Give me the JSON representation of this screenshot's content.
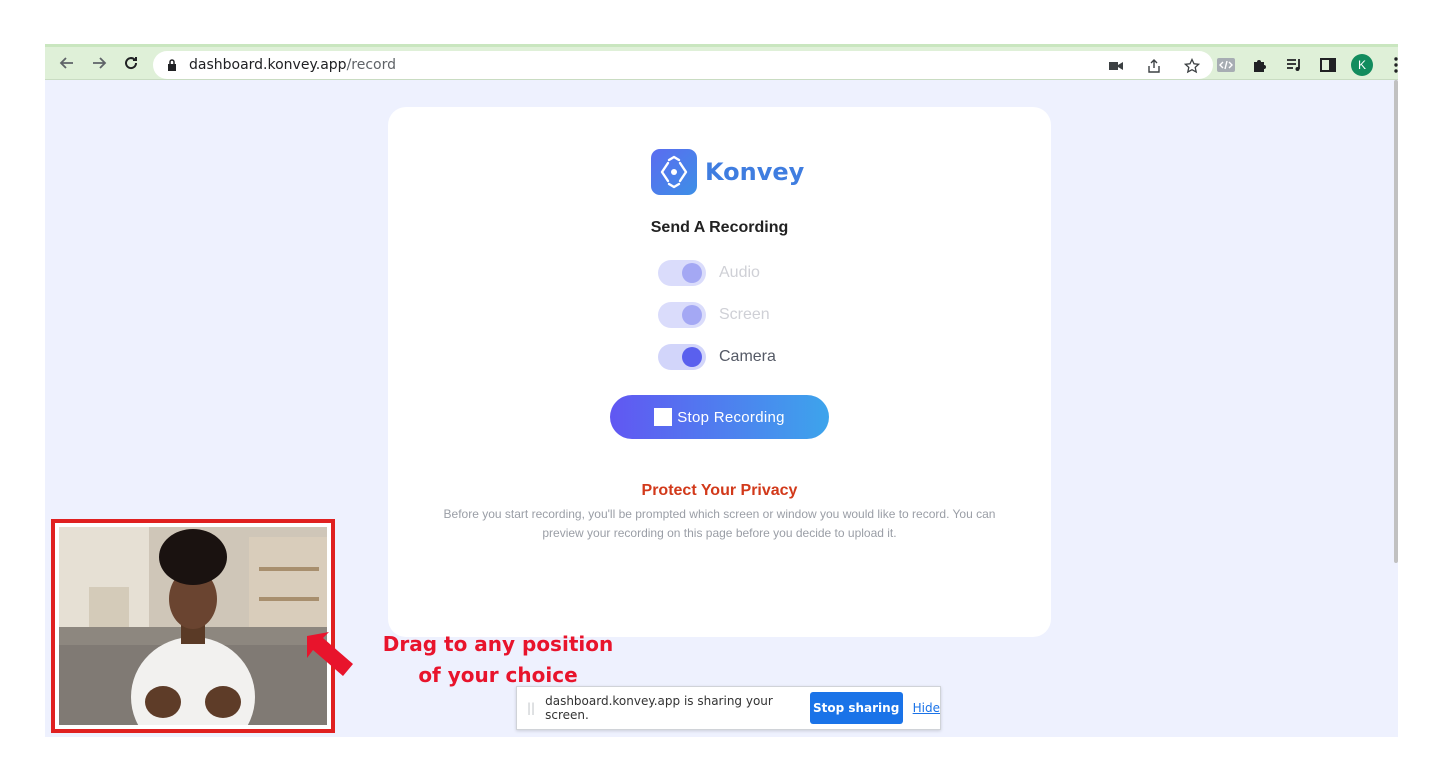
{
  "browser": {
    "url_host": "dashboard.konvey.app",
    "url_path": "/record",
    "profile_initial": "K"
  },
  "card": {
    "brand_name": "Konvey",
    "title": "Send A Recording",
    "toggles": [
      {
        "label": "Audio",
        "on": true,
        "enabled": false
      },
      {
        "label": "Screen",
        "on": true,
        "enabled": false
      },
      {
        "label": "Camera",
        "on": true,
        "enabled": true
      }
    ],
    "stop_button_label": "Stop Recording",
    "privacy_title": "Protect Your Privacy",
    "privacy_text": "Before you start recording, you'll be prompted which screen or window you would like to record. You can preview your recording on this page before you decide to upload it."
  },
  "annotation": {
    "line1": "Drag to any position",
    "line2": "of your choice"
  },
  "share_bar": {
    "message": "dashboard.konvey.app is sharing your screen.",
    "stop_label": "Stop sharing",
    "hide_label": "Hide"
  },
  "colors": {
    "accent": "#5a60ee",
    "brand": "#3f7de0",
    "privacy_title": "#d2391a",
    "annotation": "#e8142c"
  }
}
